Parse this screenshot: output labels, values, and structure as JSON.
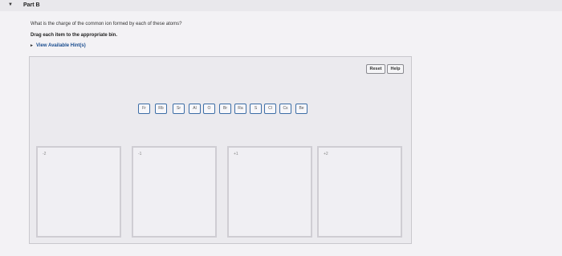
{
  "header": {
    "part_title": "Part B"
  },
  "question": {
    "text": "What is the charge of the common ion formed by each of these atoms?",
    "instruction": "Drag each item to the appropriate bin.",
    "hints_link": "View Available Hint(s)"
  },
  "toolbar": {
    "reset_label": "Reset",
    "help_label": "Help"
  },
  "tiles": [
    "Fr",
    "Rb",
    "Sr",
    "Al",
    "O",
    "Br",
    "Ra",
    "S",
    "Cl",
    "Cs",
    "Be"
  ],
  "bins": [
    "-2",
    "-1",
    "+1",
    "+2"
  ]
}
